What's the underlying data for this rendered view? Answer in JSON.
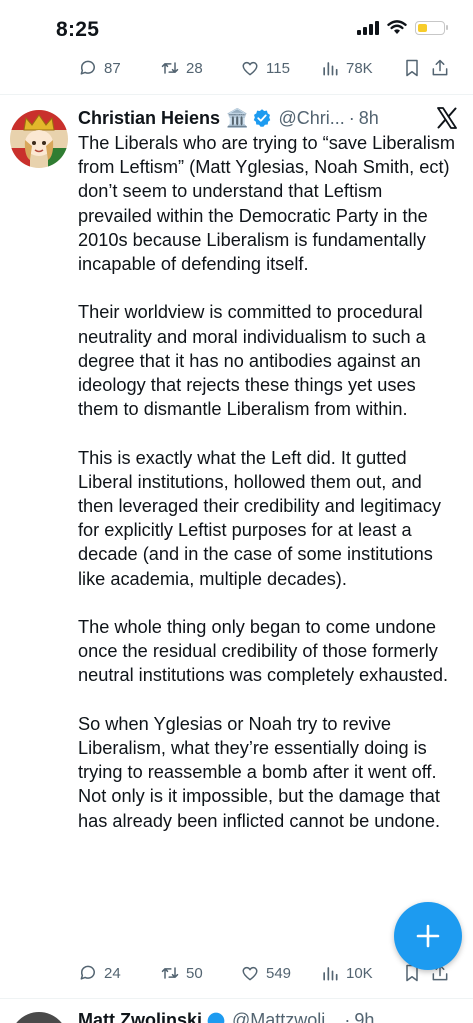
{
  "status_bar": {
    "time": "8:25"
  },
  "prev_tweet": {
    "replies": "87",
    "retweets": "28",
    "likes": "115",
    "views": "78K"
  },
  "tweet": {
    "author_name": "Christian Heiens",
    "emoji": "🏛️",
    "handle": "@Chri...",
    "separator": "·",
    "time": "8h",
    "paragraphs": [
      "The Liberals who are trying to “save Liberalism from Leftism” (Matt Yglesias, Noah Smith, ect) don’t seem to understand that Leftism prevailed within the Democratic Party in the 2010s because Liberalism is fundamentally incapable of defending itself.",
      "Their worldview is committed to procedural neutrality and moral individualism to such a degree that it has no antibodies against an ideology that rejects these things yet uses them to dismantle Liberalism from within.",
      "This is exactly what the Left did. It gutted Liberal institutions, hollowed them out, and then leveraged their credibility and legitimacy for explicitly Leftist purposes for at least a decade (and in the case of some institutions like academia, multiple decades).",
      "The whole thing only began to come undone once the residual credibility of those formerly neutral institutions was completely exhausted.",
      "So when Yglesias or Noah try to revive Liberalism, what they’re essentially doing is trying to reassemble a bomb after it went off. Not only is it impossible, but the damage that has already been inflicted cannot be undone."
    ],
    "replies": "24",
    "retweets": "50",
    "likes": "549",
    "views": "10K"
  },
  "next_tweet": {
    "author_name": "Matt Zwolinski",
    "handle": "@Mattzwoli...",
    "time": "9h"
  },
  "colors": {
    "accent": "#1d9bf0",
    "muted": "#536471",
    "battery": "#f7cc2a"
  }
}
